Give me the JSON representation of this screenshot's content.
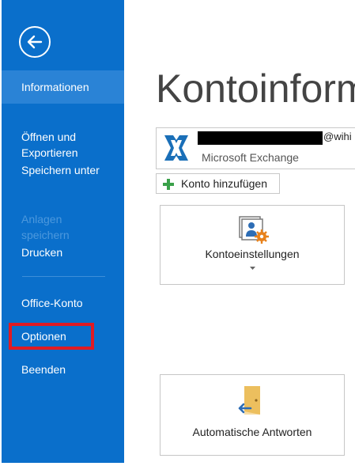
{
  "sidebar": {
    "back_icon": "back-arrow-icon",
    "items": [
      {
        "label": "Informationen",
        "state": "active"
      },
      {
        "label": "Öffnen und\nExportieren",
        "state": "normal"
      },
      {
        "label": "Speichern unter",
        "state": "normal"
      },
      {
        "label": "Anlagen\nspeichern",
        "state": "disabled"
      },
      {
        "label": "Drucken",
        "state": "normal"
      },
      {
        "label": "Office-Konto",
        "state": "normal"
      },
      {
        "label": "Optionen",
        "state": "highlighted"
      },
      {
        "label": "Beenden",
        "state": "normal"
      }
    ]
  },
  "main": {
    "title": "Kontoinform",
    "account": {
      "email_suffix": "@wihi",
      "type": "Microsoft Exchange",
      "icon": "exchange-icon"
    },
    "add_account_label": "Konto hinzufügen",
    "tiles": [
      {
        "label": "Kontoeinstellungen",
        "icon": "account-settings-icon"
      },
      {
        "label": "Automatische Antworten",
        "icon": "automatic-replies-icon"
      }
    ]
  },
  "colors": {
    "sidebar_bg": "#0a6fcb",
    "sidebar_active": "#2a83d6",
    "highlight": "#e01b23"
  }
}
